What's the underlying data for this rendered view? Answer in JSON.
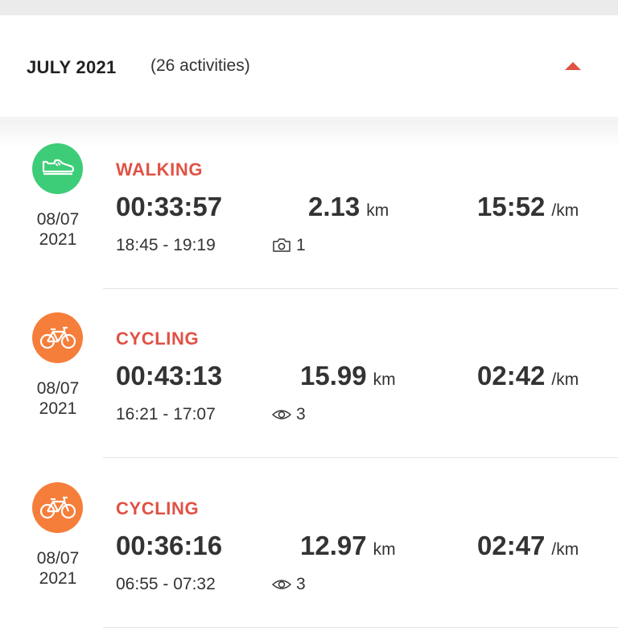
{
  "header": {
    "month": "JULY 2021",
    "count": "(26 activities)",
    "collapse_icon": "triangle-up-icon",
    "accent": "#e05245"
  },
  "activities": [
    {
      "type": "WALKING",
      "icon": "shoe-icon",
      "icon_color": "#3dcc78",
      "date_line1": "08/07",
      "date_line2": "2021",
      "duration": "00:33:57",
      "time_range": "18:45 - 19:19",
      "distance": "2.13",
      "distance_unit": "km",
      "pace": "15:52",
      "pace_unit": "/km",
      "meta_icon": "camera-icon",
      "meta_count": "1"
    },
    {
      "type": "CYCLING",
      "icon": "bicycle-icon",
      "icon_color": "#f57e3b",
      "date_line1": "08/07",
      "date_line2": "2021",
      "duration": "00:43:13",
      "time_range": "16:21 - 17:07",
      "distance": "15.99",
      "distance_unit": "km",
      "pace": "02:42",
      "pace_unit": "/km",
      "meta_icon": "eye-icon",
      "meta_count": "3"
    },
    {
      "type": "CYCLING",
      "icon": "bicycle-icon",
      "icon_color": "#f57e3b",
      "date_line1": "08/07",
      "date_line2": "2021",
      "duration": "00:36:16",
      "time_range": "06:55 - 07:32",
      "distance": "12.97",
      "distance_unit": "km",
      "pace": "02:47",
      "pace_unit": "/km",
      "meta_icon": "eye-icon",
      "meta_count": "3"
    }
  ]
}
